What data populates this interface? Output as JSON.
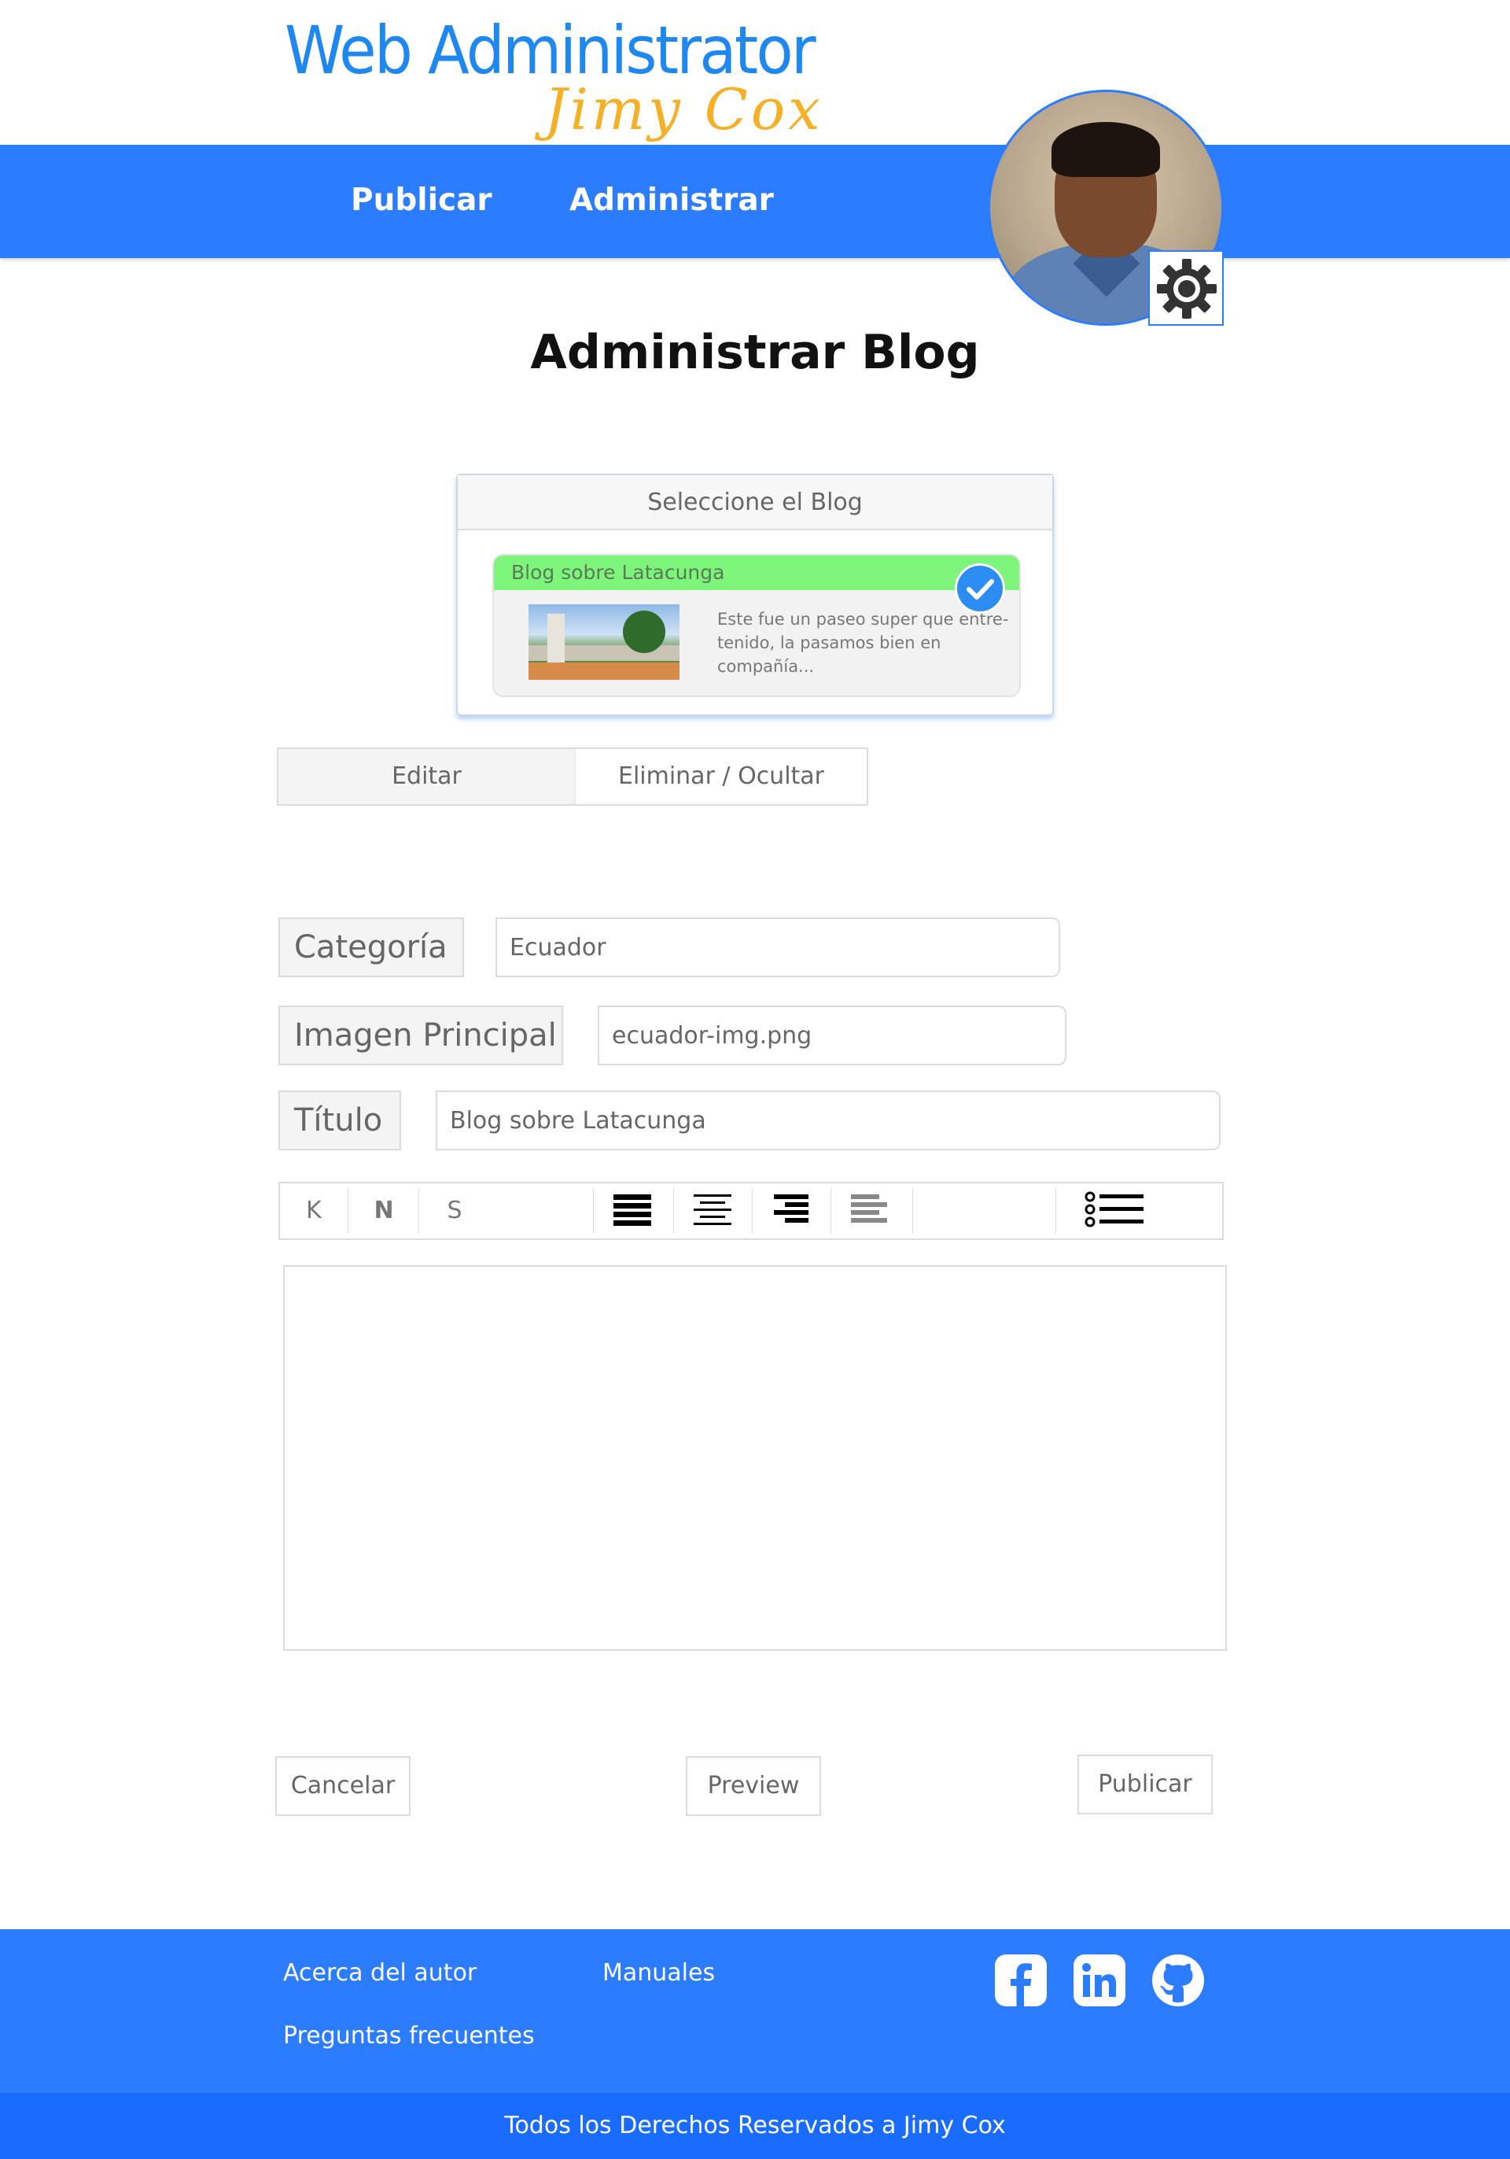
{
  "brand": {
    "title": "Web Administrator",
    "subtitle": "Jimy Cox",
    "title_color": "#1e88f0",
    "subtitle_color": "#f6b027"
  },
  "nav": {
    "items": [
      {
        "label": "Publicar"
      },
      {
        "label": "Administrar"
      }
    ],
    "background": "#2b7cff"
  },
  "profile": {
    "settings_icon": "gear-icon"
  },
  "page": {
    "title": "Administrar Blog"
  },
  "blog_selector": {
    "header": "Seleccione el Blog",
    "cards": [
      {
        "title": "Blog sobre Latacunga",
        "description": "Este fue un paseo super que entre-tenido, la pasamos bien en compañía...",
        "selected": true,
        "highlight_color": "#7cf57a"
      }
    ]
  },
  "tabs": [
    {
      "label": "Editar",
      "active": true
    },
    {
      "label": "Eliminar / Ocultar",
      "active": false
    }
  ],
  "form": {
    "categoria": {
      "label": "Categoría",
      "value": "Ecuador"
    },
    "imagen": {
      "label": "Imagen Principal",
      "value": "ecuador-img.png"
    },
    "titulo": {
      "label": "Título",
      "value": "Blog sobre Latacunga"
    }
  },
  "toolbar": {
    "italic_label": "K",
    "bold_label": "N",
    "underline_label": "S",
    "icons": [
      "align-justify-icon",
      "align-center-icon",
      "align-right-icon",
      "align-left-icon",
      "list-icon"
    ]
  },
  "editor": {
    "content": ""
  },
  "actions": {
    "cancel": "Cancelar",
    "preview": "Preview",
    "publish": "Publicar"
  },
  "footer": {
    "links": [
      {
        "label": "Acerca del autor"
      },
      {
        "label": "Manuales"
      },
      {
        "label": "Preguntas frecuentes"
      }
    ],
    "social_icons": [
      "facebook-icon",
      "linkedin-icon",
      "github-icon"
    ],
    "copyright": "Todos los Derechos Reservados a Jimy Cox",
    "background": "#2b7cff"
  }
}
